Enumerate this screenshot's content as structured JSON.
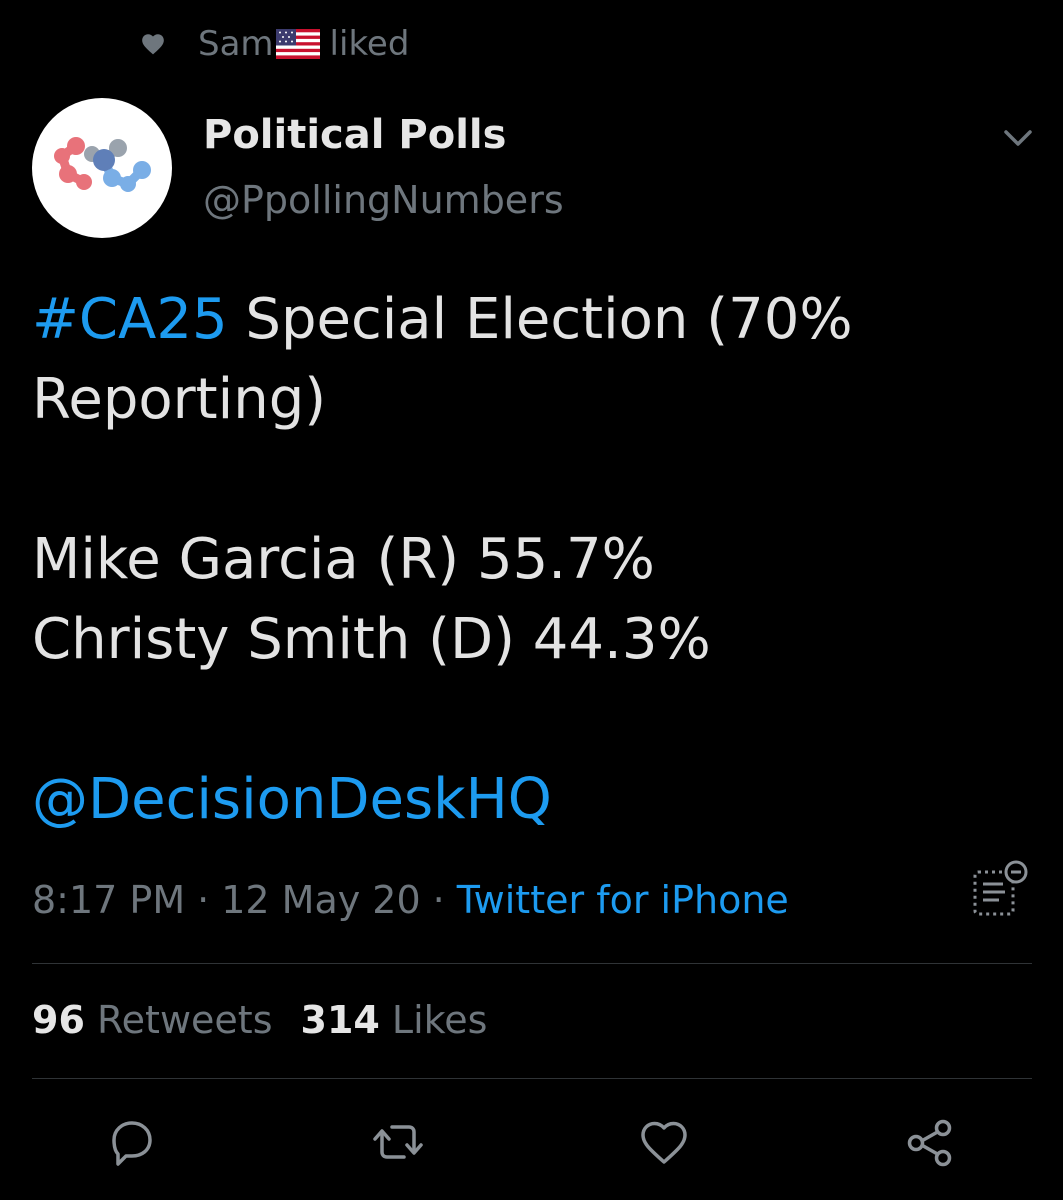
{
  "social_context": {
    "user": "Sam",
    "action": "liked"
  },
  "author": {
    "name": "Political Polls",
    "handle": "@PpollingNumbers"
  },
  "tweet": {
    "hashtag": "#CA25",
    "line1_rest": " Special Election (70%",
    "line2": "Reporting)",
    "line3": "Mike Garcia (R) 55.7%",
    "line4": "Christy Smith (D) 44.3%",
    "mention": "@DecisionDeskHQ"
  },
  "meta": {
    "time": "8:17 PM",
    "separator": "·",
    "date": "12 May 20",
    "source": "Twitter for iPhone"
  },
  "stats": {
    "retweets_count": "96",
    "retweets_label": "Retweets",
    "likes_count": "314",
    "likes_label": "Likes"
  },
  "icons": {
    "liked_context": "heart-icon",
    "caret": "chevron-down-icon",
    "translate": "translate-icon",
    "reply": "reply-icon",
    "retweet": "retweet-icon",
    "like": "like-icon",
    "share": "share-icon"
  },
  "colors": {
    "background": "#000000",
    "link": "#1d9bf0",
    "secondary_text": "#6e767d",
    "primary_text": "#e3e3e3"
  }
}
